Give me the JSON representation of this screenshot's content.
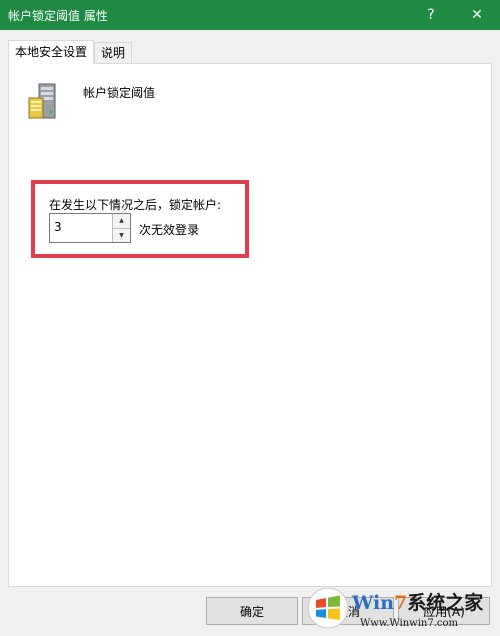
{
  "window": {
    "title": "帐户锁定阈值 属性",
    "help_glyph": "?",
    "close_glyph": "✕"
  },
  "tabs": [
    {
      "label": "本地安全设置",
      "active": true
    },
    {
      "label": "说明",
      "active": false
    }
  ],
  "policy": {
    "icon": "server-icon",
    "name": "帐户锁定阈值",
    "lock_label": "在发生以下情况之后，锁定帐户:",
    "threshold_value": "3",
    "unit_label": "次无效登录"
  },
  "footer": {
    "ok_label": "确定",
    "cancel_label": "取消",
    "apply_label": "应用(A)"
  },
  "watermark": {
    "brand_win": "Win",
    "brand_num": "7",
    "brand_cn": "系统之家",
    "url": "Www.Winwin7.com"
  },
  "colors": {
    "titlebar": "#1e8a43",
    "highlight": "#e03e4d"
  }
}
